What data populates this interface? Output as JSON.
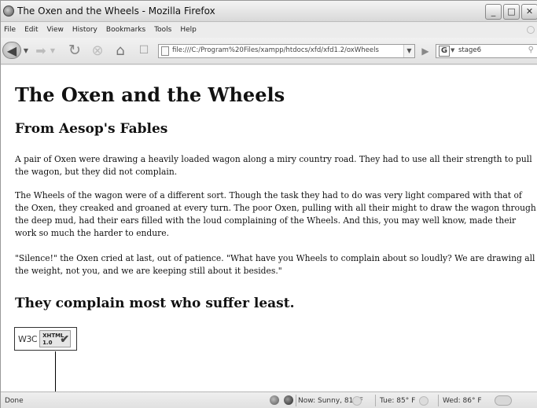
{
  "window": {
    "title": "The Oxen and the Wheels - Mozilla Firefox",
    "controls": {
      "minimize": "_",
      "maximize": "□",
      "close": "✕"
    }
  },
  "menu": [
    "File",
    "Edit",
    "View",
    "History",
    "Bookmarks",
    "Tools",
    "Help"
  ],
  "toolbar": {
    "url": "file:///C:/Program%20Files/xampp/htdocs/xfd/xfd1.2/oxWheels",
    "search_query": "stage6",
    "search_engine_letter": "G"
  },
  "page": {
    "heading": "The Oxen and the Wheels",
    "subheading": "From Aesop's Fables",
    "paragraphs": [
      "A pair of Oxen were drawing a heavily loaded wagon along a miry country road. They had to use all their strength to pull the wagon, but they did not complain.",
      "The Wheels of the wagon were of a different sort. Though the task they had to do was very light compared with that of the Oxen, they creaked and groaned at every turn. The poor Oxen, pulling with all their might to draw the wagon through the deep mud, had their ears filled with the loud complaining of the Wheels. And this, you may well know, made their work so much the harder to endure.",
      "\"Silence!\" the Oxen cried at last, out of patience. \"What have you Wheels to complain about so loudly? We are drawing all the weight, not you, and we are keeping still about it besides.\""
    ],
    "moral": "They complain most who suffer least.",
    "badge": {
      "w3c": "W3C",
      "line1": "XHTML",
      "line2": "1.0",
      "check": "✔"
    }
  },
  "status": {
    "text": "Done",
    "weather_now": "Now: Sunny, 81° F",
    "weather_tue": "Tue: 85° F",
    "weather_wed": "Wed: 86° F"
  }
}
